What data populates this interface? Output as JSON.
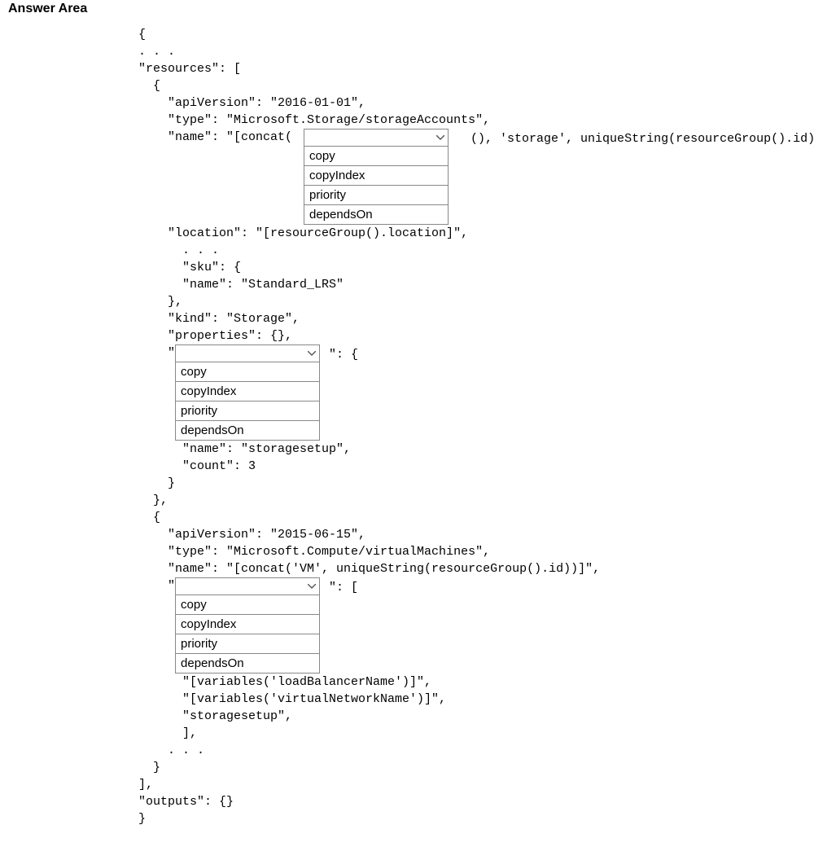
{
  "title": "Answer Area",
  "code": {
    "l1": "{",
    "l2": ". . .",
    "l3": "\"resources\": [",
    "l4": "  {",
    "l5": "    \"apiVersion\": \"2016-01-01\",",
    "l6": "    \"type\": \"Microsoft.Storage/storageAccounts\",",
    "l7a": "    \"name\": \"[concat(",
    "l7b": " (), 'storage', uniqueString(resourceGroup().id))]\",",
    "l8": "    \"location\": \"[resourceGroup().location]\",",
    "l9": "      . . .",
    "l10": "      \"sku\": {",
    "l11": "      \"name\": \"Standard_LRS\"",
    "l12": "    },",
    "l13": "    \"kind\": \"Storage\",",
    "l14": "    \"properties\": {},",
    "l15a": "    \"",
    "l15b": " \": {",
    "l16": "      \"name\": \"storagesetup\",",
    "l17": "      \"count\": 3",
    "l18": "    }",
    "l19": "  },",
    "l20": "  {",
    "l21": "    \"apiVersion\": \"2015-06-15\",",
    "l22": "    \"type\": \"Microsoft.Compute/virtualMachines\",",
    "l23": "    \"name\": \"[concat('VM', uniqueString(resourceGroup().id))]\",",
    "l24a": "    \"",
    "l24b": " \": [",
    "l25": "      \"[variables('loadBalancerName')]\",",
    "l26": "      \"[variables('virtualNetworkName')]\",",
    "l27": "      \"storagesetup\",",
    "l28": "      ],",
    "l29": "    . . .",
    "l30": "  }",
    "l31": "],",
    "l32": "\"outputs\": {}",
    "l33": "}"
  },
  "dropdown": {
    "options": {
      "o1": "copy",
      "o2": "copyIndex",
      "o3": "priority",
      "o4": "dependsOn"
    }
  }
}
